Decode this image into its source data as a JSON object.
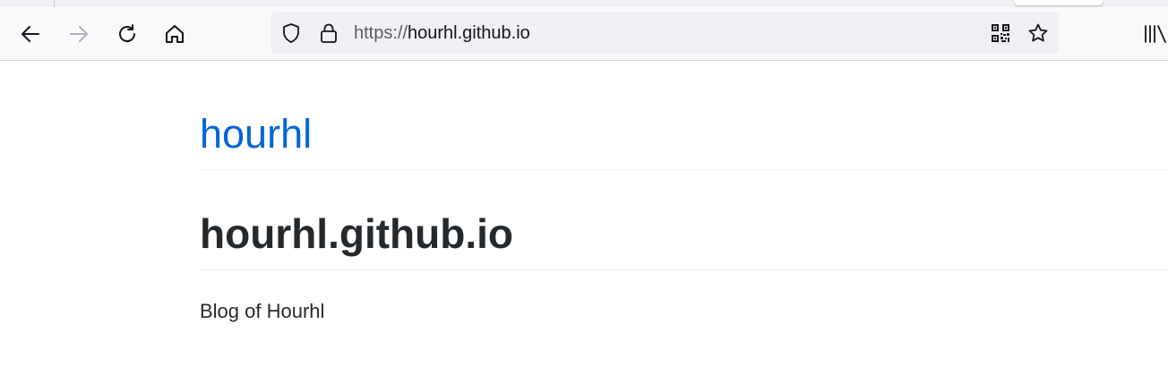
{
  "browser": {
    "toolbar": {
      "back_icon": "arrow-left-icon",
      "forward_icon": "arrow-right-icon",
      "reload_icon": "reload-icon",
      "home_icon": "home-icon",
      "library_icon": "library-icon"
    },
    "urlbar": {
      "scheme": "https://",
      "host": "hourhl.github.io",
      "shield_icon": "tracking-protection-shield-icon",
      "lock_icon": "lock-icon",
      "qr_icon": "qr-code-icon",
      "bookmark_icon": "star-icon"
    }
  },
  "page": {
    "site_title": "hourhl",
    "heading": "hourhl.github.io",
    "description": "Blog of Hourhl"
  },
  "colors": {
    "link": "#0366d6",
    "text": "#24292e",
    "rule": "#eaecef",
    "toolbar_bg": "#f9f9fb",
    "urlbar_bg": "#f0f0f4",
    "disabled_icon": "#b0b0b8"
  }
}
